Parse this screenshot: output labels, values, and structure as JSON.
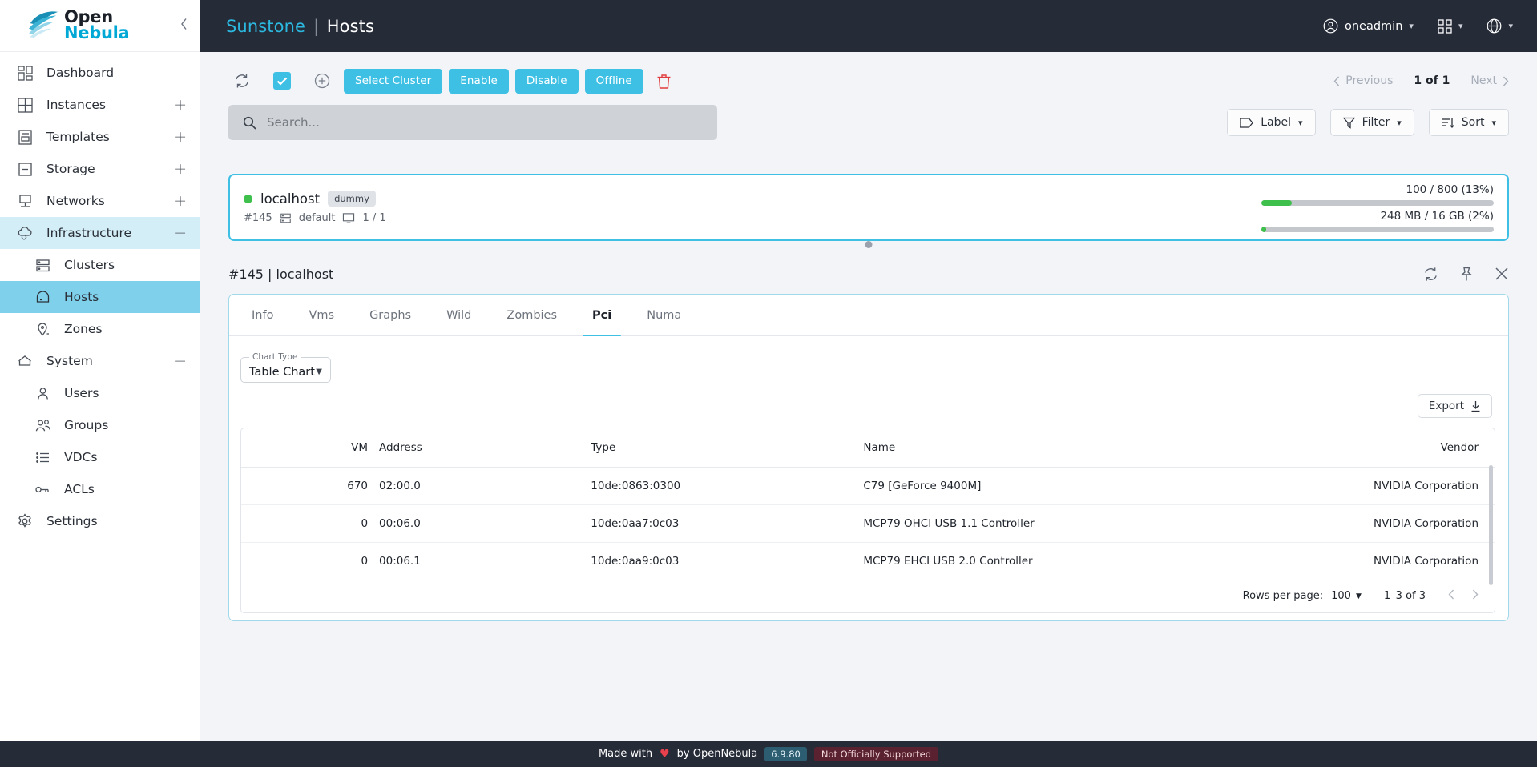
{
  "sidebar": {
    "logo": {
      "line1": "Open",
      "line2": "Nebula"
    },
    "collapse_icon": "chevron-left-icon",
    "items": [
      {
        "label": "Dashboard",
        "icon": "dashboard-icon",
        "plus": false,
        "level": "top"
      },
      {
        "label": "Instances",
        "icon": "grid-icon",
        "plus": true,
        "level": "top"
      },
      {
        "label": "Templates",
        "icon": "template-icon",
        "plus": true,
        "level": "top"
      },
      {
        "label": "Storage",
        "icon": "storage-icon",
        "plus": true,
        "level": "top"
      },
      {
        "label": "Networks",
        "icon": "network-icon",
        "plus": true,
        "level": "top"
      },
      {
        "label": "Infrastructure",
        "icon": "cloud-icon",
        "minus": true,
        "level": "top",
        "state": "expanded"
      },
      {
        "label": "Clusters",
        "icon": "cluster-icon",
        "level": "child"
      },
      {
        "label": "Hosts",
        "icon": "host-icon",
        "level": "child",
        "state": "selected"
      },
      {
        "label": "Zones",
        "icon": "zone-pin-icon",
        "level": "child"
      },
      {
        "label": "System",
        "icon": "home-icon",
        "minus": true,
        "level": "top",
        "state": "expanded"
      },
      {
        "label": "Users",
        "icon": "user-icon",
        "level": "child"
      },
      {
        "label": "Groups",
        "icon": "groups-icon",
        "level": "child"
      },
      {
        "label": "VDCs",
        "icon": "list-icon",
        "level": "child"
      },
      {
        "label": "ACLs",
        "icon": "key-icon",
        "level": "child"
      },
      {
        "label": "Settings",
        "icon": "gear-icon",
        "level": "top"
      }
    ]
  },
  "topbar": {
    "app_name": "Sunstone",
    "separator": "|",
    "section": "Hosts",
    "user": "oneadmin",
    "user_icon": "user-circle-icon",
    "apps_icon": "apps-grid-icon",
    "language_icon": "globe-icon"
  },
  "toolbar": {
    "refresh_icon": "refresh-icon",
    "select_all_icon": "checkbox-checked-icon",
    "add_icon": "plus-circle-icon",
    "buttons": [
      "Select Cluster",
      "Enable",
      "Disable",
      "Offline"
    ],
    "delete_icon": "trash-icon",
    "pagination": {
      "previous": "Previous",
      "current": "1 of 1",
      "next": "Next"
    }
  },
  "search": {
    "placeholder": "Search...",
    "value": "",
    "icon": "search-icon"
  },
  "controls": [
    {
      "label": "Label",
      "icon": "tag-icon"
    },
    {
      "label": "Filter",
      "icon": "funnel-icon"
    },
    {
      "label": "Sort",
      "icon": "sort-icon"
    }
  ],
  "host_card": {
    "status": "online",
    "status_color": "#3fbf4c",
    "name": "localhost",
    "tag": "dummy",
    "id": "#145",
    "cluster_icon": "cluster-icon",
    "cluster": "default",
    "vms_icon": "monitor-icon",
    "vms": "1 / 1",
    "cpu": {
      "label": "100 / 800 (13%)",
      "percent": 13
    },
    "memory": {
      "label": "248 MB / 16 GB (2%)",
      "percent": 2
    }
  },
  "detail": {
    "title": "#145 | localhost",
    "refresh_icon": "refresh-icon",
    "pin_icon": "pin-icon",
    "close_icon": "close-icon",
    "tabs": [
      "Info",
      "Vms",
      "Graphs",
      "Wild",
      "Zombies",
      "Pci",
      "Numa"
    ],
    "active_tab": "Pci",
    "chart_type": {
      "legend": "Chart Type",
      "value": "Table Chart"
    },
    "export": {
      "label": "Export",
      "icon": "download-icon"
    },
    "table": {
      "columns": [
        "VM",
        "Address",
        "Type",
        "Name",
        "Vendor"
      ],
      "rows": [
        {
          "vm": "670",
          "address": "02:00.0",
          "type": "10de:0863:0300",
          "name": "C79 [GeForce 9400M]",
          "vendor": "NVIDIA Corporation"
        },
        {
          "vm": "0",
          "address": "00:06.0",
          "type": "10de:0aa7:0c03",
          "name": "MCP79 OHCI USB 1.1 Controller",
          "vendor": "NVIDIA Corporation"
        },
        {
          "vm": "0",
          "address": "00:06.1",
          "type": "10de:0aa9:0c03",
          "name": "MCP79 EHCI USB 2.0 Controller",
          "vendor": "NVIDIA Corporation"
        }
      ],
      "footer": {
        "rows_per_page_label": "Rows per page:",
        "rows_per_page_value": "100",
        "range": "1–3 of 3"
      }
    }
  },
  "footer": {
    "made_with": "Made with",
    "heart": "♥",
    "by": "by OpenNebula",
    "version": "6.9.80",
    "support": "Not Officially Supported"
  }
}
